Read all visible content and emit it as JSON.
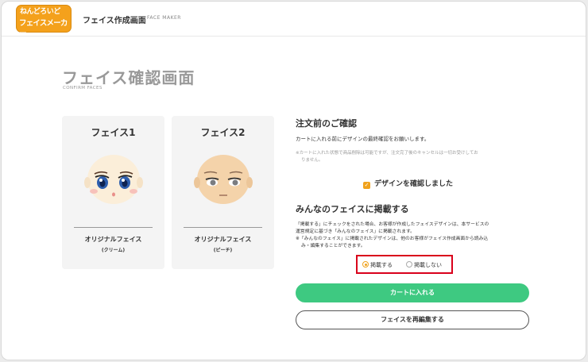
{
  "header": {
    "logo_line1": "ねんどろいど",
    "logo_line2": "フェイスメーカー",
    "title": "フェイス作成画面",
    "subtitle": "FACE MAKER"
  },
  "page": {
    "title": "フェイス確認画面",
    "subtitle": "CONFIRM FACES"
  },
  "faces": [
    {
      "label": "フェイス1",
      "name": "オリジナルフェイス",
      "color": "(クリーム)"
    },
    {
      "label": "フェイス2",
      "name": "オリジナルフェイス",
      "color": "(ピーチ)"
    }
  ],
  "confirm": {
    "heading": "注文前のご確認",
    "text": "カートに入れる前にデザインの最終確認をお願いします。",
    "note_line1": "※カートに入れた状態で商品削除は可能ですが、注文完了後のキャンセルは一切お受けしてお",
    "note_line2": "りません。",
    "checkbox_label": "デザインを確認しました"
  },
  "publish": {
    "heading": "みんなのフェイスに掲載する",
    "text_line1": "「掲載する」にチェックをされた場合、お客様が作成したフェイスデザインは、本サービスの",
    "text_line2": "運営規定に基づき「みんなのフェイス」に掲載されます。",
    "text_line3": "※「みんなのフェイス」に掲載されたデザインは、他のお客様がフェイス作成画面から読み込",
    "text_line4": "み・編集することができます。",
    "options": [
      "掲載する",
      "掲載しない"
    ],
    "selected": "掲載する"
  },
  "buttons": {
    "cart": "カートに入れる",
    "edit": "フェイスを再編集する"
  },
  "colors": {
    "accent": "#f0a21c",
    "cart_button": "#3ec981",
    "highlight_border": "#d9001b"
  }
}
